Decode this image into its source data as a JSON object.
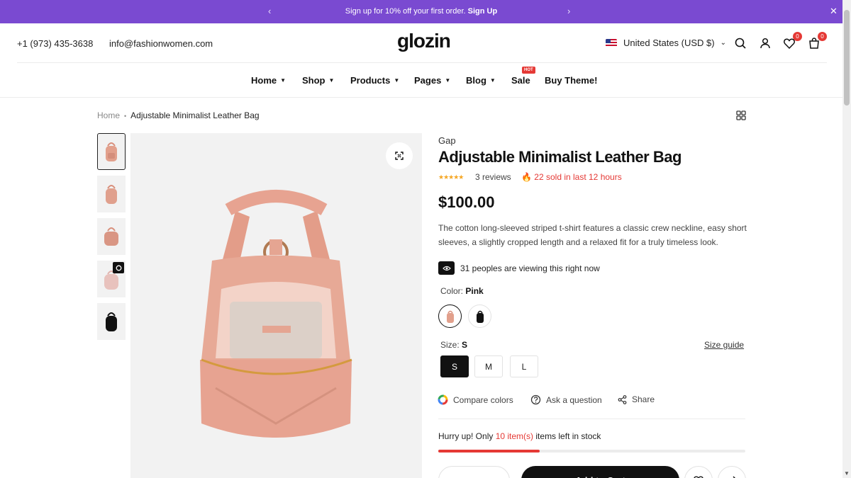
{
  "promo": {
    "text": "Sign up for 10% off your first order.",
    "link": "Sign Up",
    "prev_icon": "chevron-left-icon",
    "next_icon": "chevron-right-icon",
    "close_icon": "close-icon",
    "bg_color": "#7a4ad1"
  },
  "header": {
    "phone": "+1 (973) 435-3638",
    "email": "info@fashionwomen.com",
    "logo": "glozin",
    "region": "United States (USD $)",
    "wishlist_count": "0",
    "cart_count": "0"
  },
  "nav": {
    "items": [
      "Home",
      "Shop",
      "Products",
      "Pages",
      "Blog",
      "Sale",
      "Buy Theme!"
    ],
    "hot_badge": "HOT"
  },
  "breadcrumb": {
    "home": "Home",
    "current": "Adjustable Minimalist Leather Bag"
  },
  "product": {
    "brand": "Gap",
    "title": "Adjustable Minimalist Leather Bag",
    "rating": 5,
    "stars": "★★★★★",
    "reviews": "3 reviews",
    "sold": "22 sold in last 12 hours",
    "price": "$100.00",
    "description": "The cotton long-sleeved striped t-shirt features a classic crew neckline, easy short sleeves, a slightly cropped length and a relaxed fit for a truly timeless look.",
    "viewing": "31 peoples are viewing this right now",
    "color_label": "Color:",
    "color_value": "Pink",
    "size_label": "Size:",
    "size_value": "S",
    "size_guide": "Size guide",
    "sizes": [
      "S",
      "M",
      "L"
    ],
    "actions": {
      "compare": "Compare colors",
      "ask": "Ask a question",
      "share": "Share"
    },
    "stock": {
      "prefix": "Hurry up! Only",
      "count": "10 item(s)",
      "suffix": "items left in stock",
      "progress_fraction": 0.33
    },
    "add_to_cart": "Add to Cart",
    "accent_color": "#e53935"
  }
}
